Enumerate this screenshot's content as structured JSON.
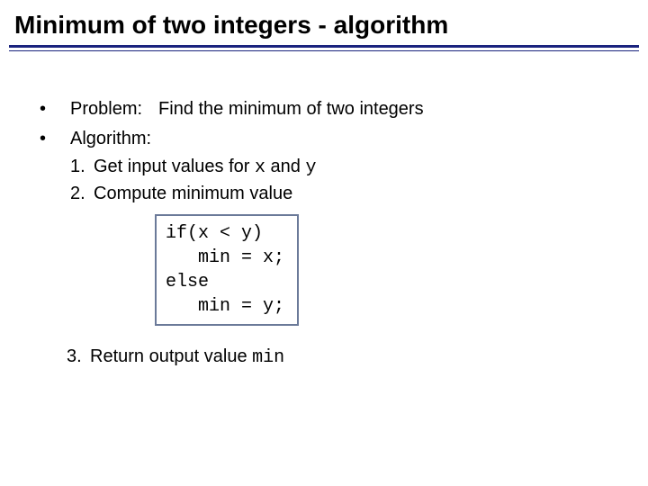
{
  "title": "Minimum of two integers - algorithm",
  "bullets": {
    "problem": {
      "label": "Problem:",
      "text": "Find the minimum of two integers"
    },
    "algorithm": {
      "label": "Algorithm:",
      "steps": {
        "s1": {
          "num": "1.",
          "pre": "Get input values for ",
          "code1": "x",
          "mid": " and ",
          "code2": "y"
        },
        "s2": {
          "num": "2.",
          "text": "Compute minimum value"
        },
        "code": "if(x < y)\n   min = x;\nelse\n   min = y;",
        "s3": {
          "num": "3.",
          "pre": "Return output value ",
          "code": "min"
        }
      }
    }
  }
}
